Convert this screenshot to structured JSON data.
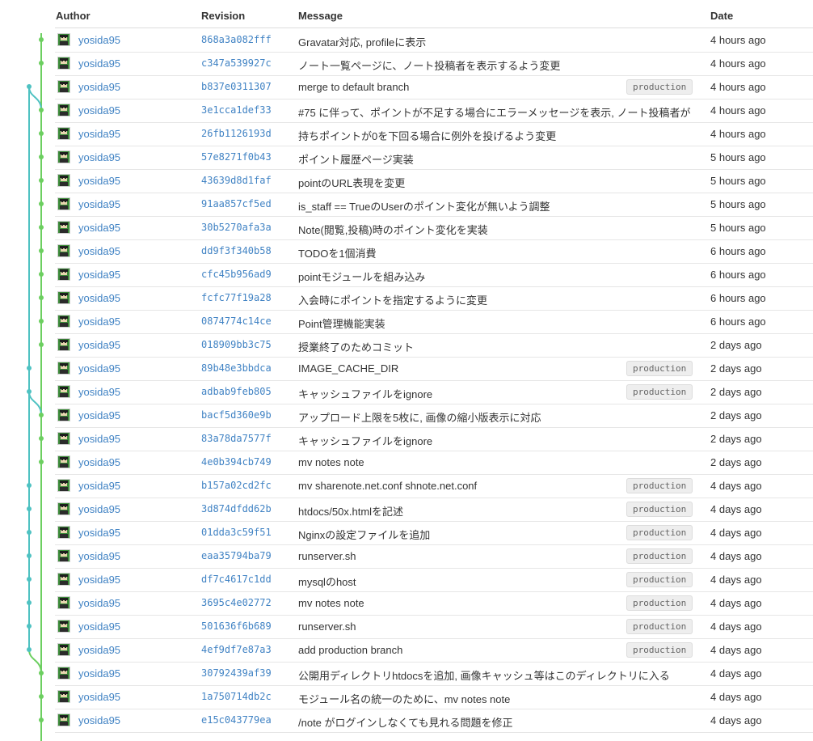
{
  "header": {
    "author": "Author",
    "revision": "Revision",
    "message": "Message",
    "date": "Date"
  },
  "colors": {
    "graph_main": "#6ccf60",
    "graph_branch": "#4fc2c2",
    "link": "#4183c4",
    "tag_bg": "#eeeeee"
  },
  "commits": [
    {
      "author": "yosida95",
      "rev": "868a3a082fff",
      "msg": "Gravatar対応, profileに表示",
      "tag": "",
      "date": "4 hours ago",
      "lane": 0
    },
    {
      "author": "yosida95",
      "rev": "c347a539927c",
      "msg": "ノート一覧ページに、ノート投稿者を表示するよう変更",
      "tag": "",
      "date": "4 hours ago",
      "lane": 0
    },
    {
      "author": "yosida95",
      "rev": "b837e0311307",
      "msg": "merge to default branch",
      "tag": "production",
      "date": "4 hours ago",
      "lane": 1
    },
    {
      "author": "yosida95",
      "rev": "3e1cca1def33",
      "msg": "#75 に伴って、ポイントが不足する場合にエラーメッセージを表示, ノート投稿者が",
      "tag": "",
      "date": "4 hours ago",
      "lane": 0
    },
    {
      "author": "yosida95",
      "rev": "26fb1126193d",
      "msg": "持ちポイントが0を下回る場合に例外を投げるよう変更",
      "tag": "",
      "date": "4 hours ago",
      "lane": 0
    },
    {
      "author": "yosida95",
      "rev": "57e8271f0b43",
      "msg": "ポイント履歴ページ実装",
      "tag": "",
      "date": "5 hours ago",
      "lane": 0
    },
    {
      "author": "yosida95",
      "rev": "43639d8d1faf",
      "msg": "pointのURL表現を変更",
      "tag": "",
      "date": "5 hours ago",
      "lane": 0
    },
    {
      "author": "yosida95",
      "rev": "91aa857cf5ed",
      "msg": "is_staff == TrueのUserのポイント変化が無いよう調整",
      "tag": "",
      "date": "5 hours ago",
      "lane": 0
    },
    {
      "author": "yosida95",
      "rev": "30b5270afa3a",
      "msg": "Note(閲覧,投稿)時のポイント変化を実装",
      "tag": "",
      "date": "5 hours ago",
      "lane": 0
    },
    {
      "author": "yosida95",
      "rev": "dd9f3f340b58",
      "msg": "TODOを1個消費",
      "tag": "",
      "date": "6 hours ago",
      "lane": 0
    },
    {
      "author": "yosida95",
      "rev": "cfc45b956ad9",
      "msg": "pointモジュールを組み込み",
      "tag": "",
      "date": "6 hours ago",
      "lane": 0
    },
    {
      "author": "yosida95",
      "rev": "fcfc77f19a28",
      "msg": "入会時にポイントを指定するように変更",
      "tag": "",
      "date": "6 hours ago",
      "lane": 0
    },
    {
      "author": "yosida95",
      "rev": "0874774c14ce",
      "msg": "Point管理機能実装",
      "tag": "",
      "date": "6 hours ago",
      "lane": 0
    },
    {
      "author": "yosida95",
      "rev": "018909bb3c75",
      "msg": "授業終了のためコミット",
      "tag": "",
      "date": "2 days ago",
      "lane": 0
    },
    {
      "author": "yosida95",
      "rev": "89b48e3bbdca",
      "msg": "IMAGE_CACHE_DIR",
      "tag": "production",
      "date": "2 days ago",
      "lane": 1
    },
    {
      "author": "yosida95",
      "rev": "adbab9feb805",
      "msg": "キャッシュファイルをignore",
      "tag": "production",
      "date": "2 days ago",
      "lane": 1
    },
    {
      "author": "yosida95",
      "rev": "bacf5d360e9b",
      "msg": "アップロード上限を5枚に, 画像の縮小版表示に対応",
      "tag": "",
      "date": "2 days ago",
      "lane": 0
    },
    {
      "author": "yosida95",
      "rev": "83a78da7577f",
      "msg": "キャッシュファイルをignore",
      "tag": "",
      "date": "2 days ago",
      "lane": 0
    },
    {
      "author": "yosida95",
      "rev": "4e0b394cb749",
      "msg": "mv notes note",
      "tag": "",
      "date": "2 days ago",
      "lane": 0
    },
    {
      "author": "yosida95",
      "rev": "b157a02cd2fc",
      "msg": "mv sharenote.net.conf shnote.net.conf",
      "tag": "production",
      "date": "4 days ago",
      "lane": 1
    },
    {
      "author": "yosida95",
      "rev": "3d874dfdd62b",
      "msg": "htdocs/50x.htmlを記述",
      "tag": "production",
      "date": "4 days ago",
      "lane": 1
    },
    {
      "author": "yosida95",
      "rev": "01dda3c59f51",
      "msg": "Nginxの設定ファイルを追加",
      "tag": "production",
      "date": "4 days ago",
      "lane": 1
    },
    {
      "author": "yosida95",
      "rev": "eaa35794ba79",
      "msg": "runserver.sh",
      "tag": "production",
      "date": "4 days ago",
      "lane": 1
    },
    {
      "author": "yosida95",
      "rev": "df7c4617c1dd",
      "msg": "mysqlのhost",
      "tag": "production",
      "date": "4 days ago",
      "lane": 1
    },
    {
      "author": "yosida95",
      "rev": "3695c4e02772",
      "msg": "mv notes note",
      "tag": "production",
      "date": "4 days ago",
      "lane": 1
    },
    {
      "author": "yosida95",
      "rev": "501636f6b689",
      "msg": "runserver.sh",
      "tag": "production",
      "date": "4 days ago",
      "lane": 1
    },
    {
      "author": "yosida95",
      "rev": "4ef9df7e87a3",
      "msg": "add production branch",
      "tag": "production",
      "date": "4 days ago",
      "lane": 1
    },
    {
      "author": "yosida95",
      "rev": "30792439af39",
      "msg": "公開用ディレクトリhtdocsを追加, 画像キャッシュ等はこのディレクトリに入る",
      "tag": "",
      "date": "4 days ago",
      "lane": 0
    },
    {
      "author": "yosida95",
      "rev": "1a750714db2c",
      "msg": "モジュール名の統一のために、mv notes note",
      "tag": "",
      "date": "4 days ago",
      "lane": 0
    },
    {
      "author": "yosida95",
      "rev": "e15c043779ea",
      "msg": "/note がログインしなくても見れる問題を修正",
      "tag": "",
      "date": "4 days ago",
      "lane": 0
    }
  ]
}
